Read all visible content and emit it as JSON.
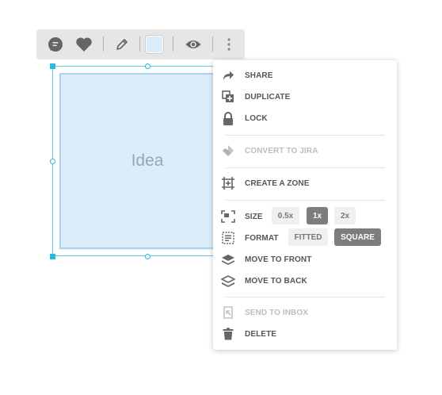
{
  "toolbar": {
    "buttons": [
      {
        "icon": "comment-icon"
      },
      {
        "icon": "heart-icon"
      },
      {
        "icon": "pencil-icon"
      },
      {
        "icon": "color-swatch-icon",
        "color": "#dbecfb"
      },
      {
        "icon": "eye-icon"
      },
      {
        "icon": "more-vertical-icon"
      }
    ]
  },
  "note": {
    "text": "Idea",
    "background": "#dbecfb",
    "selection_color": "#2ab7e0"
  },
  "menu": {
    "share": {
      "label": "SHARE",
      "icon": "share-icon"
    },
    "duplicate": {
      "label": "DUPLICATE",
      "icon": "duplicate-icon"
    },
    "lock": {
      "label": "LOCK",
      "icon": "lock-icon"
    },
    "convert_to_jira": {
      "label": "CONVERT TO JIRA",
      "icon": "jira-icon",
      "disabled": true
    },
    "create_zone": {
      "label": "CREATE A ZONE",
      "icon": "zone-icon"
    },
    "size": {
      "label": "SIZE",
      "icon": "size-icon",
      "options": [
        "0.5x",
        "1x",
        "2x"
      ],
      "selected": "1x"
    },
    "format": {
      "label": "FORMAT",
      "icon": "format-icon",
      "options": [
        "FITTED",
        "SQUARE"
      ],
      "selected": "SQUARE"
    },
    "move_to_front": {
      "label": "MOVE TO FRONT",
      "icon": "move-to-front-icon"
    },
    "move_to_back": {
      "label": "MOVE TO BACK",
      "icon": "move-to-back-icon"
    },
    "send_to_inbox": {
      "label": "SEND TO INBOX",
      "icon": "inbox-icon",
      "disabled": true
    },
    "delete": {
      "label": "DELETE",
      "icon": "trash-icon"
    }
  }
}
